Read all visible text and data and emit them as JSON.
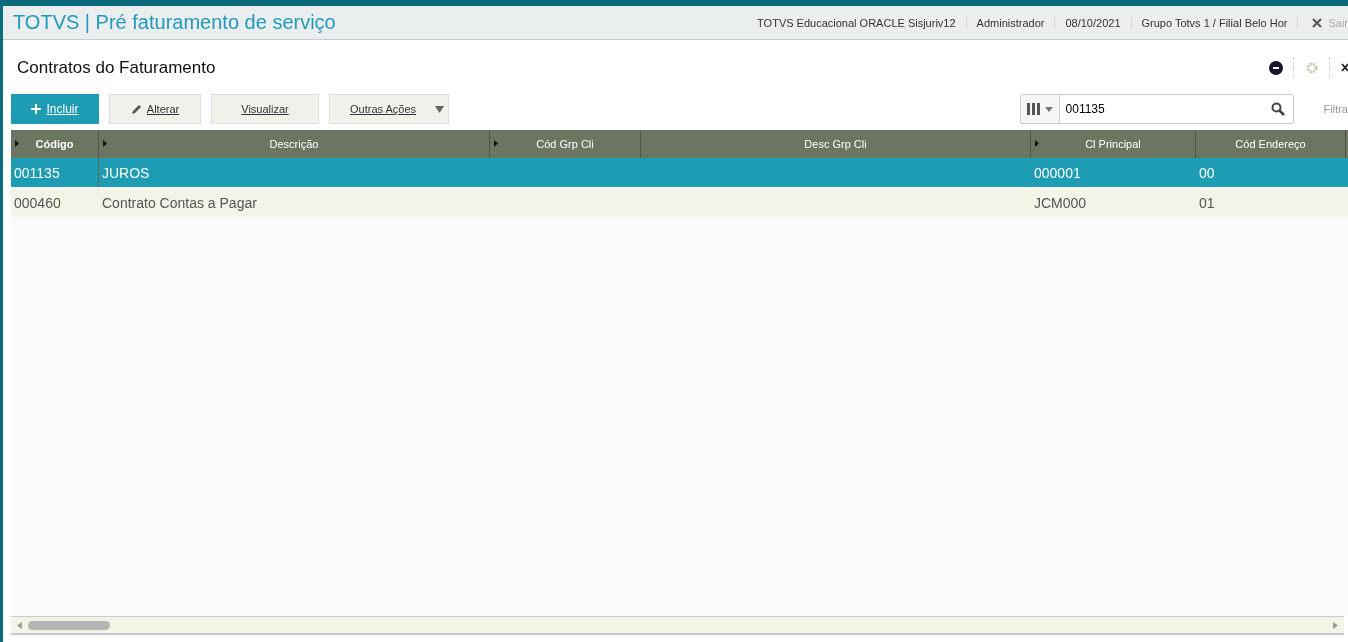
{
  "window": {
    "title": "TOTVS | Pré faturamento de serviço",
    "info": [
      "TOTVS Educacional ORACLE Sisjuriv12",
      "Administrador",
      "08/10/2021",
      "Grupo Totvs 1 / Filial Belo Hor"
    ],
    "exit": "Sair"
  },
  "page": {
    "title": "Contratos do Faturamento"
  },
  "toolbar": {
    "buttons": [
      {
        "label": "Incluir",
        "kind": "primary"
      },
      {
        "label": "Alterar",
        "kind": "edit"
      },
      {
        "label": "Visualizar",
        "kind": "plain"
      },
      {
        "label": "Outras Ações",
        "kind": "dropdown"
      }
    ],
    "search": {
      "value": "001135"
    },
    "filter": "Filtra"
  },
  "table": {
    "columns": [
      {
        "label": "Código",
        "menu": true
      },
      {
        "label": "Descrição",
        "menu": true
      },
      {
        "label": "Cód Grp Cli",
        "menu": true
      },
      {
        "label": "Desc Grp Cli",
        "menu": false
      },
      {
        "label": "Cl Principal",
        "menu": true
      },
      {
        "label": "Cód Endereço",
        "menu": false
      }
    ],
    "rows": [
      {
        "cells": [
          "001135",
          "JUROS",
          "",
          "",
          "000001",
          "00"
        ],
        "selected": true
      },
      {
        "cells": [
          "000460",
          "Contrato Contas a Pagar",
          "",
          "",
          "JCM000",
          "01"
        ],
        "selected": false
      }
    ]
  }
}
